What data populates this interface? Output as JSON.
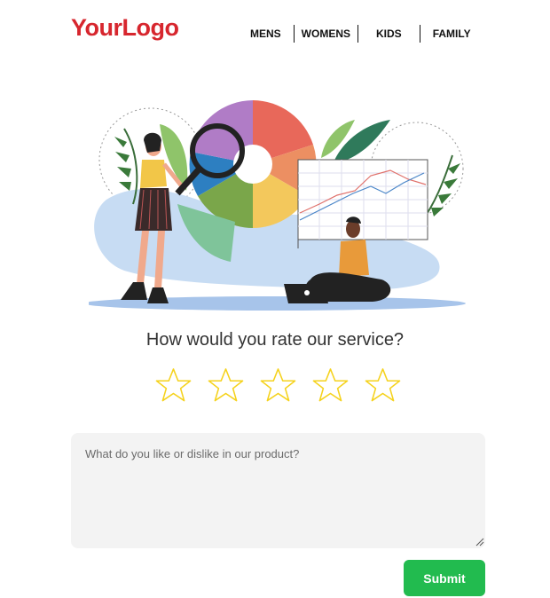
{
  "header": {
    "logo_text": "YourLogo",
    "logo_color": "#d7262e",
    "nav": [
      {
        "label": "MENS"
      },
      {
        "label": "WOMENS"
      },
      {
        "label": "KIDS"
      },
      {
        "label": "FAMILY"
      }
    ]
  },
  "rating": {
    "question": "How would you rate our service?",
    "max_stars": 5,
    "selected": 0,
    "star_color": "#f5d21c"
  },
  "feedback": {
    "placeholder": "What do you like or dislike in our product?",
    "value": ""
  },
  "submit_label": "Submit",
  "submit_color": "#22bb4f"
}
